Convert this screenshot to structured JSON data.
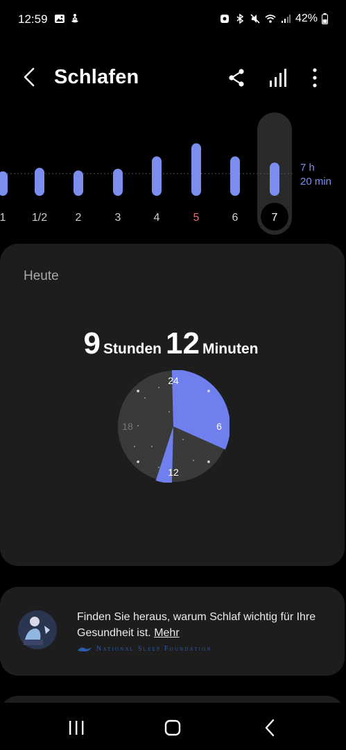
{
  "status_bar": {
    "time": "12:59",
    "battery": "42%"
  },
  "header": {
    "title": "Schlafen",
    "back_icon": "back-arrow-icon",
    "share_icon": "share-icon",
    "stats_icon": "bar-chart-icon",
    "more_icon": "more-vert-icon"
  },
  "week_chart": {
    "days": [
      {
        "label": "1",
        "hours": 5.6
      },
      {
        "label": "1/2",
        "hours": 6.4
      },
      {
        "label": "2",
        "hours": 5.8
      },
      {
        "label": "3",
        "hours": 6.2
      },
      {
        "label": "4",
        "hours": 9.0
      },
      {
        "label": "5",
        "hours": 12.0,
        "highlight": true
      },
      {
        "label": "6",
        "hours": 9.0
      },
      {
        "label": "7",
        "hours": 7.6,
        "selected": true
      }
    ],
    "average_line": "7 h",
    "average_line2": "20 min",
    "bar_color": "#7b8ef0",
    "highlight_color": "#e8706f"
  },
  "today": {
    "label": "Heute",
    "hours_value": "9",
    "hours_unit": "Stunden",
    "minutes_value": "12",
    "minutes_unit": "Minuten",
    "clock_labels": {
      "top": "24",
      "right": "6",
      "bottom": "12",
      "left": "18"
    },
    "sleep_segments": [
      {
        "start": 23.9,
        "end": 7.6
      },
      {
        "start": 12.1,
        "end": 13.2
      }
    ],
    "sleep_color": "#6f80ee"
  },
  "tip": {
    "text": "Finden Sie heraus, warum Schlaf wichtig für Ihre Gesundheit ist.",
    "link": "Mehr",
    "source": "National Sleep Foundation"
  },
  "nav": {
    "recents_icon": "recents-icon",
    "home_icon": "home-icon",
    "back_icon": "nav-back-icon"
  }
}
